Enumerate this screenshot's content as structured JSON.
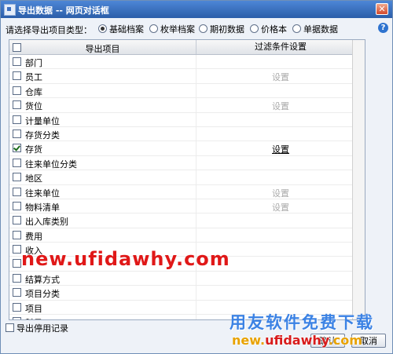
{
  "window": {
    "title": "导出数据 -- 网页对话框",
    "close_label": "✕"
  },
  "type_selector": {
    "label": "请选择导出项目类型：",
    "options": [
      {
        "label": "基础档案",
        "selected": true
      },
      {
        "label": "枚举档案",
        "selected": false
      },
      {
        "label": "期初数据",
        "selected": false
      },
      {
        "label": "价格本",
        "selected": false
      },
      {
        "label": "单据数据",
        "selected": false
      }
    ],
    "help_label": "?"
  },
  "table": {
    "headers": {
      "export_item": "导出项目",
      "filter": "过滤条件设置"
    },
    "rows": [
      {
        "name": "部门",
        "checked": false,
        "filter": ""
      },
      {
        "name": "员工",
        "checked": false,
        "filter": "设置",
        "filter_enabled": false
      },
      {
        "name": "仓库",
        "checked": false,
        "filter": ""
      },
      {
        "name": "货位",
        "checked": false,
        "filter": "设置",
        "filter_enabled": false
      },
      {
        "name": "计量单位",
        "checked": false,
        "filter": ""
      },
      {
        "name": "存货分类",
        "checked": false,
        "filter": ""
      },
      {
        "name": "存货",
        "checked": true,
        "filter": "设置",
        "filter_enabled": true
      },
      {
        "name": "往来单位分类",
        "checked": false,
        "filter": ""
      },
      {
        "name": "地区",
        "checked": false,
        "filter": ""
      },
      {
        "name": "往来单位",
        "checked": false,
        "filter": "设置",
        "filter_enabled": false
      },
      {
        "name": "物料清单",
        "checked": false,
        "filter": "设置",
        "filter_enabled": false
      },
      {
        "name": "出入库类别",
        "checked": false,
        "filter": ""
      },
      {
        "name": "费用",
        "checked": false,
        "filter": ""
      },
      {
        "name": "收入",
        "checked": false,
        "filter": ""
      },
      {
        "name": "",
        "checked": false,
        "filter": ""
      },
      {
        "name": "结算方式",
        "checked": false,
        "filter": ""
      },
      {
        "name": "项目分类",
        "checked": false,
        "filter": ""
      },
      {
        "name": "项目",
        "checked": false,
        "filter": ""
      },
      {
        "name": "科目",
        "checked": false,
        "filter": ""
      }
    ]
  },
  "footer": {
    "export_disabled_label": "导出停用记录",
    "ok_label": "确认",
    "cancel_label": "取消"
  },
  "watermarks": {
    "line1": "new.ufidawhy.com",
    "line2": "用友软件免费下载",
    "line3_a": "new.",
    "line3_b": "ufidawhy",
    "line3_c": ".com"
  }
}
